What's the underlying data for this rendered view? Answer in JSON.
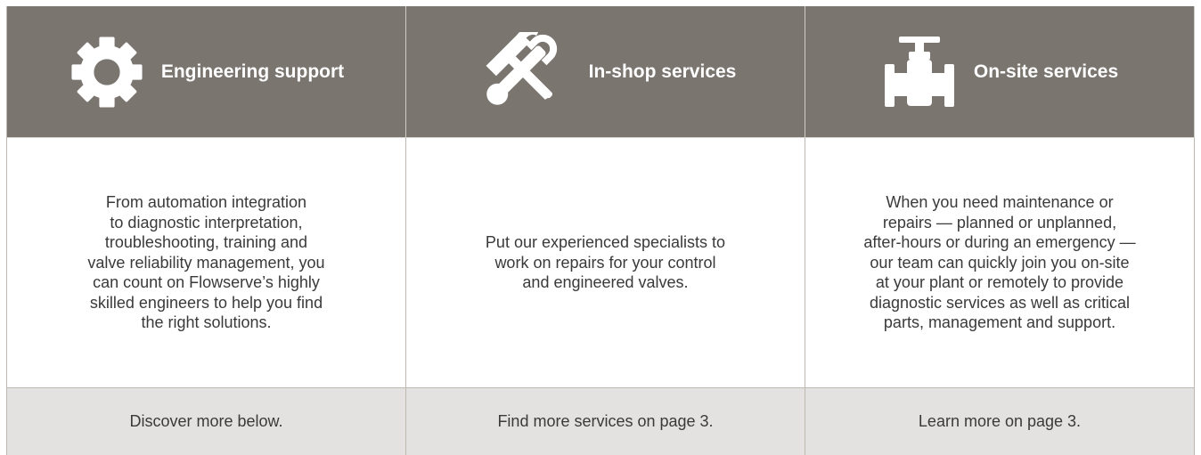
{
  "columns": [
    {
      "icon": "gear-icon",
      "title": "Engineering support",
      "lines": [
        "From automation integration",
        "to diagnostic interpretation,",
        "troubleshooting, training and",
        "valve reliability management, you",
        "can count on Flowserve’s highly",
        "skilled engineers to help you find",
        "the right solutions."
      ],
      "footer": "Discover more below."
    },
    {
      "icon": "wrench-hammer-icon",
      "title": "In-shop services",
      "lines": [
        "Put our experienced specialists to",
        "work on repairs for your control",
        "and engineered valves."
      ],
      "footer": "Find more services on page 3."
    },
    {
      "icon": "valve-icon",
      "title": "On-site services",
      "lines": [
        "When you need maintenance or",
        "repairs — planned or unplanned,",
        "after-hours or during an emergency —",
        "our team can quickly join you on-site",
        "at your plant or remotely to provide",
        "diagnostic services as well as critical",
        "parts, management and support."
      ],
      "footer": "Learn more on page 3."
    }
  ],
  "colors": {
    "header_bg": "#7b7570",
    "footer_bg": "#e4e2e0",
    "text": "#3a3a3a"
  }
}
